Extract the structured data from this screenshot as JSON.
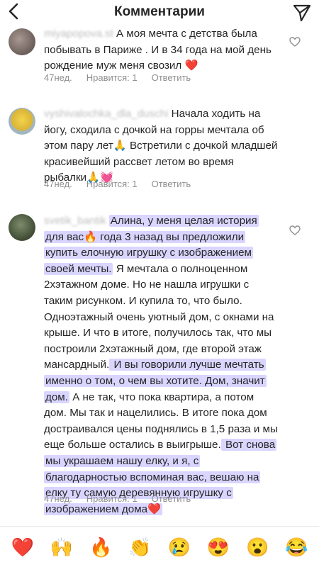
{
  "header": {
    "title": "Комментарии"
  },
  "comments": [
    {
      "username": "miyapopova.st",
      "text": "А моя мечта с детства была побывать в Париже . И в 34 года на мой день рождение муж меня свозил ❤️",
      "time": "47нед.",
      "likes": "Нравится: 1",
      "reply": "Ответить"
    },
    {
      "username": "vyshivalochka_dla_duschi",
      "text": "Начала ходить на йогу, сходила с дочкой на горры мечтала об этом пару лет🙏 Встретили с дочкой младшей красивейший рассвет летом во время рыбалки🙏💓",
      "time": "47нед.",
      "likes": "Нравится: 1",
      "reply": "Ответить"
    },
    {
      "username": "svetik_bantik",
      "segments": [
        {
          "text": "Алина, у меня целая история для вас🔥 года 3 назад вы предложили купить елочную игрушку с изображением своей мечты.",
          "highlight": true
        },
        {
          "text": " Я мечтала о полноценном  2хэтажном доме. Но не нашла игрушки с таким рисунком. И купила то, что было. Одноэтажный очень уютный дом, с окнами на крыше. И что в итоге, получилось так, что мы построили 2хэтажный дом, где второй этаж мансардный.",
          "highlight": false
        },
        {
          "text": " И вы говорили лучше мечтать именно о том, о чем вы хотите. Дом, значит дом.",
          "highlight": true
        },
        {
          "text": " А не так, что пока квартира, а потом дом. Мы так и нацелились. В итоге пока дом достраивался цены поднялись в 1,5 раза и мы еще больше остались в выигрыше.",
          "highlight": false
        },
        {
          "text": " Вот снова мы украшаем нашу елку, и я, с благодарностью вспоминая вас, вешаю на елку ту самую деревянную игрушку с изображением дома❤️",
          "highlight": true
        }
      ],
      "time": "47нед.",
      "likes": "Нравится: 1",
      "reply": "Ответить"
    }
  ],
  "emoji_bar": [
    "❤️",
    "🙌",
    "🔥",
    "👏",
    "😢",
    "😍",
    "😮",
    "😂"
  ]
}
